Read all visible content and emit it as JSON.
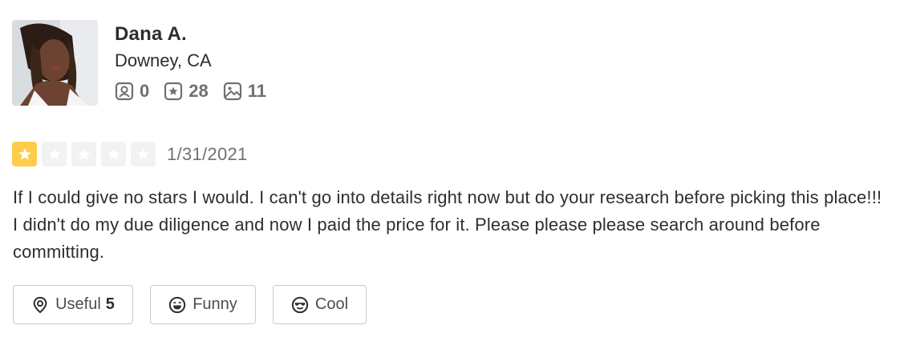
{
  "user": {
    "name": "Dana A.",
    "location": "Downey, CA",
    "stats": {
      "friends": "0",
      "reviews": "28",
      "photos": "11"
    }
  },
  "review": {
    "rating": 1,
    "max_rating": 5,
    "date": "1/31/2021",
    "text": "If I could give no stars I would. I can't go into details right now but do your research before picking this place!!! I didn't do my due diligence and now I paid the price for it. Please please please search around before committing."
  },
  "reactions": {
    "useful_label": "Useful",
    "useful_count": "5",
    "funny_label": "Funny",
    "cool_label": "Cool"
  },
  "colors": {
    "star_filled": "#ffcc4b",
    "star_empty": "#f2f2f2",
    "text_primary": "#2d2e2f",
    "text_secondary": "#6e7072",
    "button_border": "#c8c9ca"
  },
  "icons": {
    "friends": "friends-icon",
    "reviews": "review-star-icon",
    "photos": "photo-icon",
    "useful": "useful-lightbulb-icon",
    "funny": "funny-face-icon",
    "cool": "cool-sunglasses-icon",
    "star": "star-icon"
  }
}
